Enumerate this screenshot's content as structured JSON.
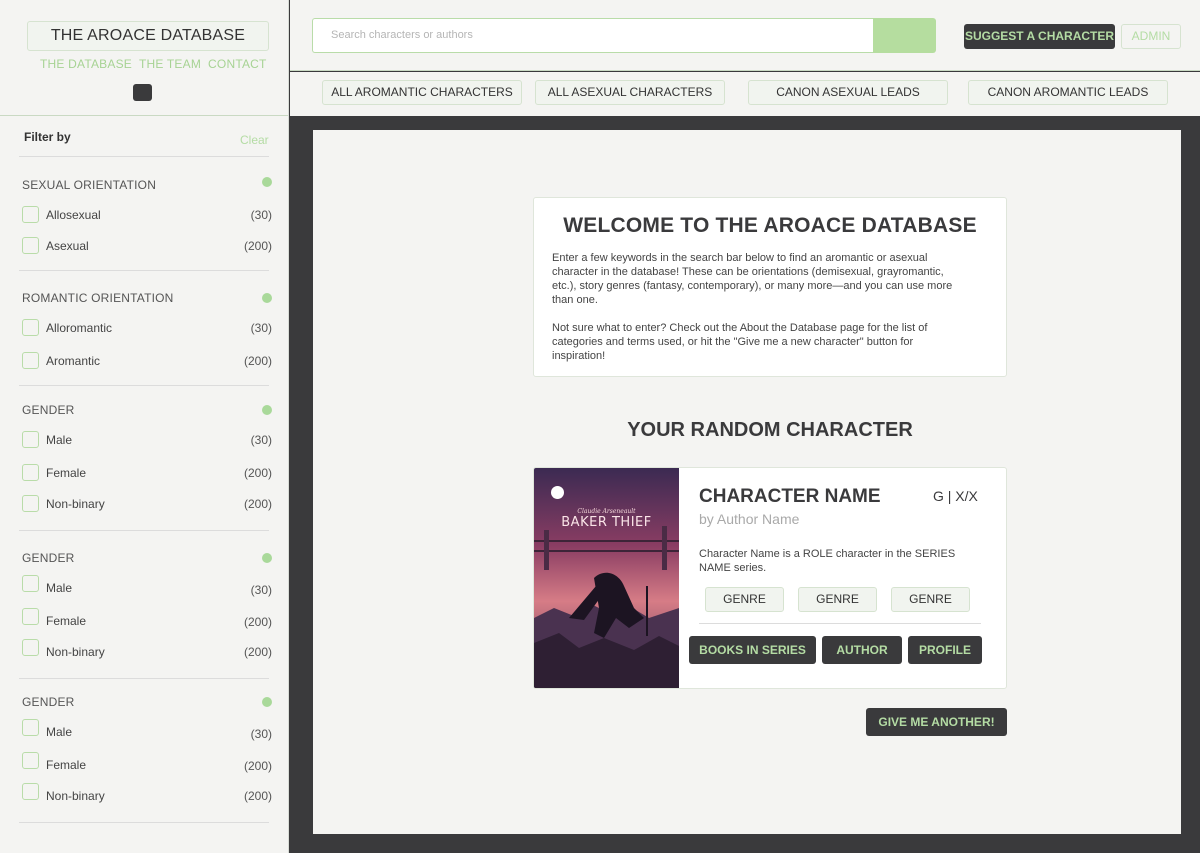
{
  "brand": {
    "title": "THE AROACE DATABASE",
    "links": [
      "THE DATABASE",
      "THE TEAM",
      "CONTACT"
    ]
  },
  "filters": {
    "heading": "Filter by",
    "clear_label": "Clear",
    "groups": [
      {
        "title": "SEXUAL ORIENTATION",
        "options": [
          {
            "label": "Allosexual",
            "count": "(30)"
          },
          {
            "label": "Asexual",
            "count": "(200)"
          }
        ]
      },
      {
        "title": "ROMANTIC ORIENTATION",
        "options": [
          {
            "label": "Alloromantic",
            "count": "(30)"
          },
          {
            "label": "Aromantic",
            "count": "(200)"
          }
        ]
      },
      {
        "title": "GENDER",
        "options": [
          {
            "label": "Male",
            "count": "(30)"
          },
          {
            "label": "Female",
            "count": "(200)"
          },
          {
            "label": "Non-binary",
            "count": "(200)"
          }
        ]
      },
      {
        "title": "GENDER",
        "options": [
          {
            "label": "Male",
            "count": "(30)"
          },
          {
            "label": "Female",
            "count": "(200)"
          },
          {
            "label": "Non-binary",
            "count": "(200)"
          }
        ]
      },
      {
        "title": "GENDER",
        "options": [
          {
            "label": "Male",
            "count": "(30)"
          },
          {
            "label": "Female",
            "count": "(200)"
          },
          {
            "label": "Non-binary",
            "count": "(200)"
          }
        ]
      }
    ]
  },
  "header": {
    "search_placeholder": "Search characters or authors",
    "suggest_label": "SUGGEST A CHARACTER",
    "admin_label": "ADMIN"
  },
  "categories": [
    "ALL AROMANTIC CHARACTERS",
    "ALL ASEXUAL CHARACTERS",
    "CANON ASEXUAL LEADS",
    "CANON AROMANTIC LEADS"
  ],
  "welcome": {
    "title": "WELCOME TO THE AROACE DATABASE",
    "paragraph1": "Enter a few keywords in the search bar below to find an aromantic or asexual character in the database! These can be orientations (demisexual, grayromantic, etc.), story genres (fantasy, contemporary), or many more—and you can use more than one.",
    "paragraph2": "Not sure what to enter? Check out the About the Database page for the list of categories and terms used, or hit the \"Give me a new character\" button for inspiration!"
  },
  "random": {
    "title": "YOUR RANDOM CHARACTER",
    "cover_author": "Claudie Arseneault",
    "cover_title": "BAKER THIEF",
    "name": "CHARACTER NAME",
    "rating": "G | X/X",
    "author": "by Author Name",
    "description": "Character Name is a ROLE character in the SERIES NAME series.",
    "genres": [
      "GENRE",
      "GENRE",
      "GENRE"
    ],
    "buttons": {
      "books": "BOOKS IN SERIES",
      "author": "AUTHOR",
      "profile": "PROFILE"
    },
    "another_label": "GIVE ME ANOTHER!"
  }
}
